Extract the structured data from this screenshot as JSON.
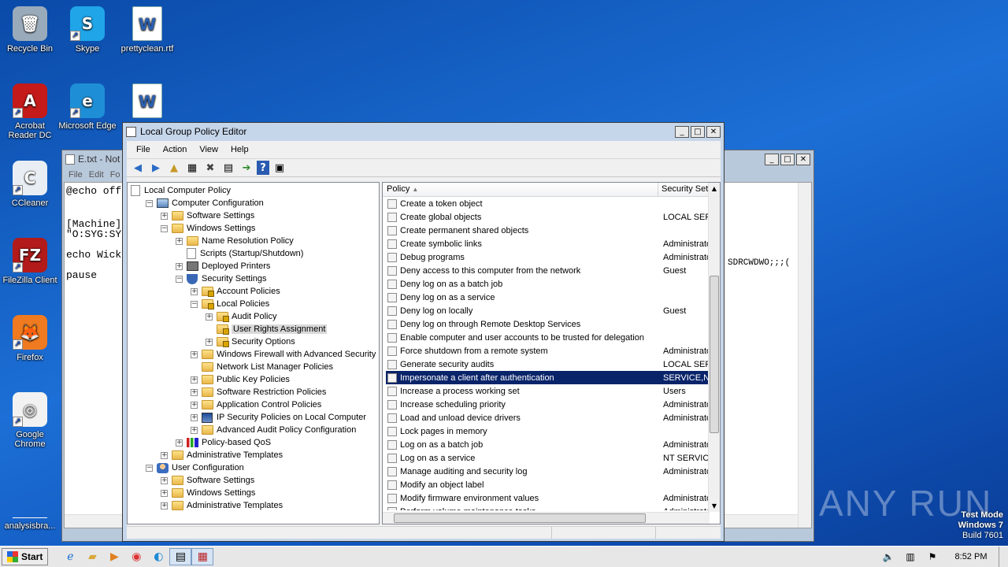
{
  "desktop": {
    "icons": [
      {
        "label": "Recycle Bin",
        "glyph": "🗑"
      },
      {
        "label": "Skype",
        "glyph": "S"
      },
      {
        "label": "prettyclean.rtf",
        "glyph": "W"
      },
      {
        "label": "Acrobat Reader DC",
        "glyph": "A"
      },
      {
        "label": "Microsoft Edge",
        "glyph": "e"
      },
      {
        "label": "",
        "glyph": "W"
      },
      {
        "label": "CCleaner",
        "glyph": "C"
      },
      {
        "label": "FileZilla Client",
        "glyph": "FZ"
      },
      {
        "label": "Firefox",
        "glyph": "🦊"
      },
      {
        "label": "Google Chrome",
        "glyph": "◎"
      },
      {
        "label": "analysisbra...",
        "glyph": ""
      }
    ],
    "watermark": "ANY RUN",
    "test_mode": [
      "Test Mode",
      "Windows 7",
      "Build 7601"
    ]
  },
  "notepad": {
    "title": "E.txt - Not",
    "menu": [
      "File",
      "Edit",
      "Fo"
    ],
    "lines": [
      "@echo off",
      "",
      "[Machine]",
      "\"O:SYG:SY",
      "echo Wick",
      "",
      "pause"
    ],
    "right_fragment": "SDRCWDWO;;;("
  },
  "gpedit": {
    "title": "Local Group Policy Editor",
    "menu": [
      "File",
      "Action",
      "View",
      "Help"
    ],
    "tree": [
      {
        "label": "Local Computer Policy"
      },
      {
        "label": "Computer Configuration"
      },
      {
        "label": "Software Settings"
      },
      {
        "label": "Windows Settings"
      },
      {
        "label": "Name Resolution Policy"
      },
      {
        "label": "Scripts (Startup/Shutdown)"
      },
      {
        "label": "Deployed Printers"
      },
      {
        "label": "Security Settings"
      },
      {
        "label": "Account Policies"
      },
      {
        "label": "Local Policies"
      },
      {
        "label": "Audit Policy"
      },
      {
        "label": "User Rights Assignment"
      },
      {
        "label": "Security Options"
      },
      {
        "label": "Windows Firewall with Advanced Security"
      },
      {
        "label": "Network List Manager Policies"
      },
      {
        "label": "Public Key Policies"
      },
      {
        "label": "Software Restriction Policies"
      },
      {
        "label": "Application Control Policies"
      },
      {
        "label": "IP Security Policies on Local Computer"
      },
      {
        "label": "Advanced Audit Policy Configuration"
      },
      {
        "label": "Policy-based QoS"
      },
      {
        "label": "Administrative Templates"
      },
      {
        "label": "User Configuration"
      },
      {
        "label": "Software Settings"
      },
      {
        "label": "Windows Settings"
      },
      {
        "label": "Administrative Templates"
      }
    ],
    "columns": {
      "policy": "Policy",
      "setting": "Security Setti"
    },
    "policies": [
      {
        "name": "Create a token object",
        "setting": ""
      },
      {
        "name": "Create global objects",
        "setting": "LOCAL SERV"
      },
      {
        "name": "Create permanent shared objects",
        "setting": ""
      },
      {
        "name": "Create symbolic links",
        "setting": "Administrato"
      },
      {
        "name": "Debug programs",
        "setting": "Administrato"
      },
      {
        "name": "Deny access to this computer from the network",
        "setting": "Guest"
      },
      {
        "name": "Deny log on as a batch job",
        "setting": ""
      },
      {
        "name": "Deny log on as a service",
        "setting": ""
      },
      {
        "name": "Deny log on locally",
        "setting": "Guest"
      },
      {
        "name": "Deny log on through Remote Desktop Services",
        "setting": ""
      },
      {
        "name": "Enable computer and user accounts to be trusted for delegation",
        "setting": ""
      },
      {
        "name": "Force shutdown from a remote system",
        "setting": "Administrato"
      },
      {
        "name": "Generate security audits",
        "setting": "LOCAL SERV"
      },
      {
        "name": "Impersonate a client after authentication",
        "setting": "SERVICE,NE"
      },
      {
        "name": "Increase a process working set",
        "setting": "Users"
      },
      {
        "name": "Increase scheduling priority",
        "setting": "Administrato"
      },
      {
        "name": "Load and unload device drivers",
        "setting": "Administrato"
      },
      {
        "name": "Lock pages in memory",
        "setting": ""
      },
      {
        "name": "Log on as a batch job",
        "setting": "Administrato"
      },
      {
        "name": "Log on as a service",
        "setting": "NT SERVICE'"
      },
      {
        "name": "Manage auditing and security log",
        "setting": "Administrato"
      },
      {
        "name": "Modify an object label",
        "setting": ""
      },
      {
        "name": "Modify firmware environment values",
        "setting": "Administrato"
      },
      {
        "name": "Perform volume maintenance tasks",
        "setting": "Administrato"
      }
    ],
    "selected_index": 13
  },
  "taskbar": {
    "start": "Start",
    "clock": "8:52 PM"
  },
  "colors": {
    "selection": "#0a246a",
    "desktop": "#1c6fd6"
  }
}
